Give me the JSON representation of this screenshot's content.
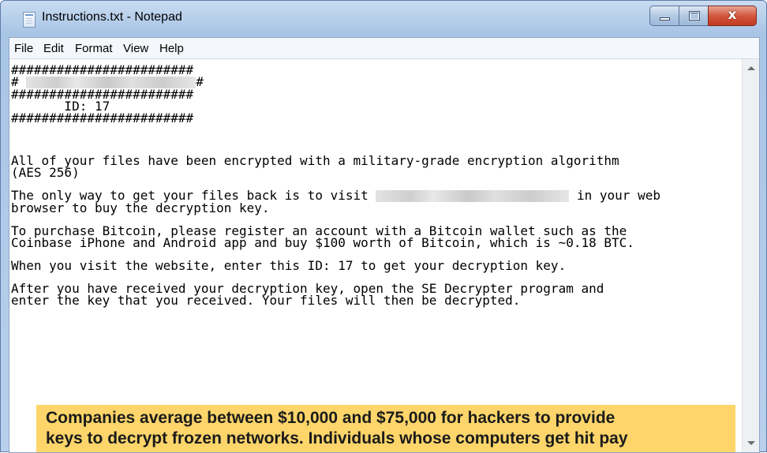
{
  "window": {
    "title": "Instructions.txt - Notepad",
    "close_glyph": "x"
  },
  "menu": {
    "file": "File",
    "edit": "Edit",
    "format": "Format",
    "view": "View",
    "help": "Help"
  },
  "note": {
    "hash_line": "########################",
    "hash_left": "#",
    "hash_right": "#",
    "id_line": "       ID: 17",
    "para1": "All of your files have been encrypted with a military-grade encryption algorithm\n(AES 256)",
    "para2_a": "The only way to get your files back is to visit ",
    "para2_b": " in your web\nbrowser to buy the decryption key.",
    "para3": "To purchase Bitcoin, please register an account with a Bitcoin wallet such as the\nCoinbase iPhone and Android app and buy $100 worth of Bitcoin, which is ~0.18 BTC.",
    "para4": "When you visit the website, enter this ID: 17 to get your decryption key.",
    "para5": "After you have received your decryption key, open the SE Decrypter program and\nenter the key that you received. Your files will then be decrypted."
  },
  "overlay_caption": {
    "line1": "Companies average between $10,000 and $75,000 for hackers to provide",
    "line2": "keys to decrypt frozen networks. Individuals whose computers get hit pay"
  },
  "colors": {
    "caption_bg": "#fdd56a",
    "close_button": "#c2391f",
    "titlebar": "#b8d0ec"
  }
}
